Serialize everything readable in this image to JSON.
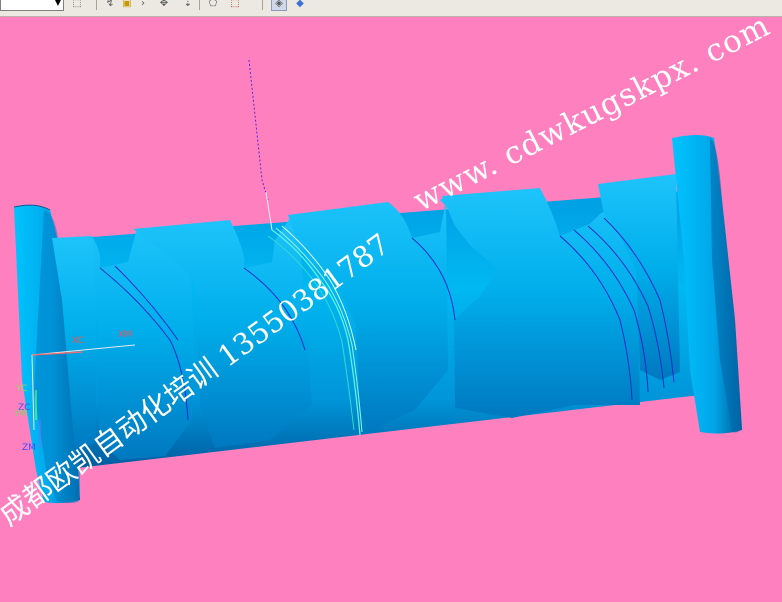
{
  "toolbar": {
    "combo_value": "",
    "buttons": [
      {
        "name": "snap-icon",
        "glyph": "⬚"
      },
      {
        "name": "point-filter-icon",
        "glyph": "↯"
      },
      {
        "name": "select-feature-icon",
        "glyph": "▣"
      },
      {
        "name": "arrow-right-icon",
        "glyph": "›"
      },
      {
        "name": "move-icon",
        "glyph": "✥"
      },
      {
        "name": "pin-icon",
        "glyph": "⇣"
      },
      {
        "name": "polygon-select-icon",
        "glyph": "⬠"
      },
      {
        "name": "box-select-icon",
        "glyph": "⬚"
      },
      {
        "name": "shaded-view-icon",
        "glyph": "◈"
      },
      {
        "name": "solid-cube-icon",
        "glyph": "◆"
      }
    ]
  },
  "viewport": {
    "background": "#ff80bf",
    "part_color": "#00bfff"
  },
  "triad": {
    "xc": "XC",
    "xm": "XM",
    "yc": "YC",
    "zc": "ZC",
    "ym": "YM",
    "zm": "ZM"
  },
  "watermark": {
    "url": "www. cdwkugskpx. com",
    "chinese": "成都欧凯自动化培训 13550381787"
  }
}
